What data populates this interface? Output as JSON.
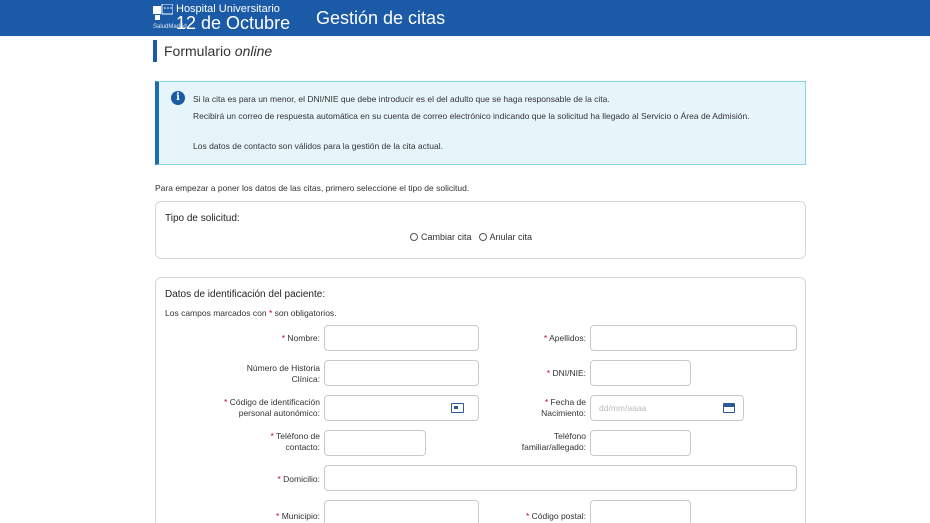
{
  "header": {
    "logo_small_text": "SaludMadrid",
    "hospital_line1": "Hospital Universitario",
    "hospital_line2": "12 de Octubre",
    "app_title": "Gestión de citas",
    "background_color": "#1a5aa6"
  },
  "page": {
    "subtitle_prefix": "Formulario",
    "subtitle_emphasis": "online"
  },
  "alert": {
    "icon": "info-icon",
    "lines": [
      "Si la cita es para un menor, el DNI/NIE que debe introducir es el del adulto que se haga responsable de la cita.",
      "Recibirá un correo de respuesta automática en su cuenta de correo electrónico indicando que la solicitud ha llegado al Servicio o Área de Admisión.",
      "Los datos de contacto son válidos para la gestión de la cita actual."
    ]
  },
  "intro_text": "Para empezar a poner los datos de las citas, primero seleccione el tipo de solicitud.",
  "request_type": {
    "title": "Tipo de solicitud:",
    "options": [
      "Cambiar cita",
      "Anular cita"
    ]
  },
  "patient": {
    "title": "Datos de identificación del paciente:",
    "note_prefix": "Los campos marcados con",
    "note_star": "*",
    "note_suffix": "son obligatorios.",
    "fields": {
      "nombre": "Nombre:",
      "apellidos": "Apellidos:",
      "historia_1": "Número de Historia",
      "historia_2": "Clínica:",
      "dni": "DNI/NIE:",
      "codigo_1": "Código de identificación",
      "codigo_2": "personal autonómico:",
      "fecha_1": "Fecha de",
      "fecha_2": "Nacimiento:",
      "fecha_placeholder": "dd/mm/aaaa",
      "telefono_1": "Teléfono de",
      "telefono_2": "contacto:",
      "familiar_1": "Teléfono",
      "familiar_2": "familiar/allegado:",
      "domicilio": "Domicilio:",
      "municipio": "Municipio:",
      "codigo_postal": "Código postal:"
    },
    "required_marker": "*"
  }
}
